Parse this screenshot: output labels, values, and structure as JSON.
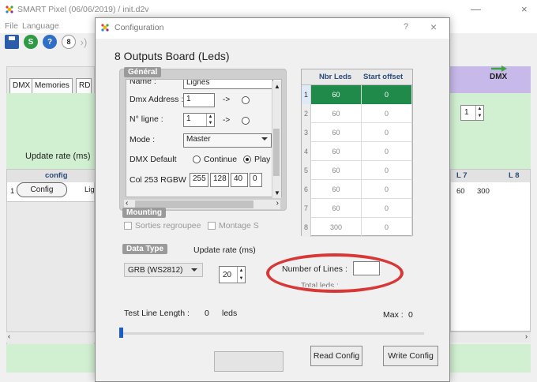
{
  "main_window": {
    "title": "SMART Pixel (06/06/2019)  /   init.d2v",
    "minimize": "—",
    "close": "×",
    "menu": [
      "File",
      "Language"
    ],
    "toolbar": {
      "s_label": "S",
      "q_label": "?",
      "eight_label": "8",
      "more_label": "›)"
    },
    "tabs": [
      "DMX",
      "Memories",
      "RD"
    ],
    "update_rate_label": "Update rate (ms)",
    "grid_left": {
      "header": "config",
      "row_number": "1",
      "button_label": "Config",
      "partial_text": "Lig"
    },
    "right": {
      "dmx_label": "DMX",
      "spin_value": "1",
      "headers": [
        "L 7",
        "L 8"
      ],
      "values": [
        "60",
        "300"
      ]
    }
  },
  "dialog": {
    "title": "Configuration",
    "help": "?",
    "close": "×",
    "heading": "8 Outputs Board (Leds)",
    "general": {
      "group_label": "Général",
      "name_label": "Name :",
      "name_value": "Lignes",
      "dmx_address_label": "Dmx Address :",
      "dmx_address_value": "1",
      "arrow": "->",
      "ligne_label": "N° ligne :",
      "ligne_value": "1",
      "mode_label": "Mode :",
      "mode_value": "Master",
      "dmx_default_label": "DMX Default",
      "opt_continue": "Continue",
      "opt_play": "Play L",
      "col253_label": "Col 253 RGBW",
      "col253_values": [
        "255",
        "128",
        "40",
        "0"
      ]
    },
    "mounting": {
      "group_label": "Mounting",
      "sorties": "Sorties regroupee",
      "montage": "Montage S"
    },
    "data_type": {
      "group_label": "Data Type",
      "update_rate_label": "Update rate (ms)",
      "type_value": "GRB (WS2812)",
      "update_value": "20"
    },
    "table": {
      "headers": [
        "Nbr Leds",
        "Start offset"
      ],
      "rows": [
        {
          "num": "1",
          "leds": "60",
          "offset": "0"
        },
        {
          "num": "2",
          "leds": "60",
          "offset": "0"
        },
        {
          "num": "3",
          "leds": "60",
          "offset": "0"
        },
        {
          "num": "4",
          "leds": "60",
          "offset": "0"
        },
        {
          "num": "5",
          "leds": "60",
          "offset": "0"
        },
        {
          "num": "6",
          "leds": "60",
          "offset": "0"
        },
        {
          "num": "7",
          "leds": "60",
          "offset": "0"
        },
        {
          "num": "8",
          "leds": "300",
          "offset": "0"
        }
      ]
    },
    "number_of_lines_label": "Number of Lines :",
    "number_of_lines_value": "",
    "total_leds_label": "Total leds :",
    "test_line_length_label": "Test Line Length :",
    "test_line_length_value": "0",
    "test_line_units": "leds",
    "max_label": "Max :",
    "max_value": "0",
    "slider_value": 0,
    "read_config": "Read Config",
    "write_config": "Write Config",
    "colors": {
      "selected_row": "#1f8a4a",
      "annotation_ellipse": "#d93636",
      "accent_header": "#c7b9e9",
      "panel_green": "#d1efd1"
    }
  }
}
